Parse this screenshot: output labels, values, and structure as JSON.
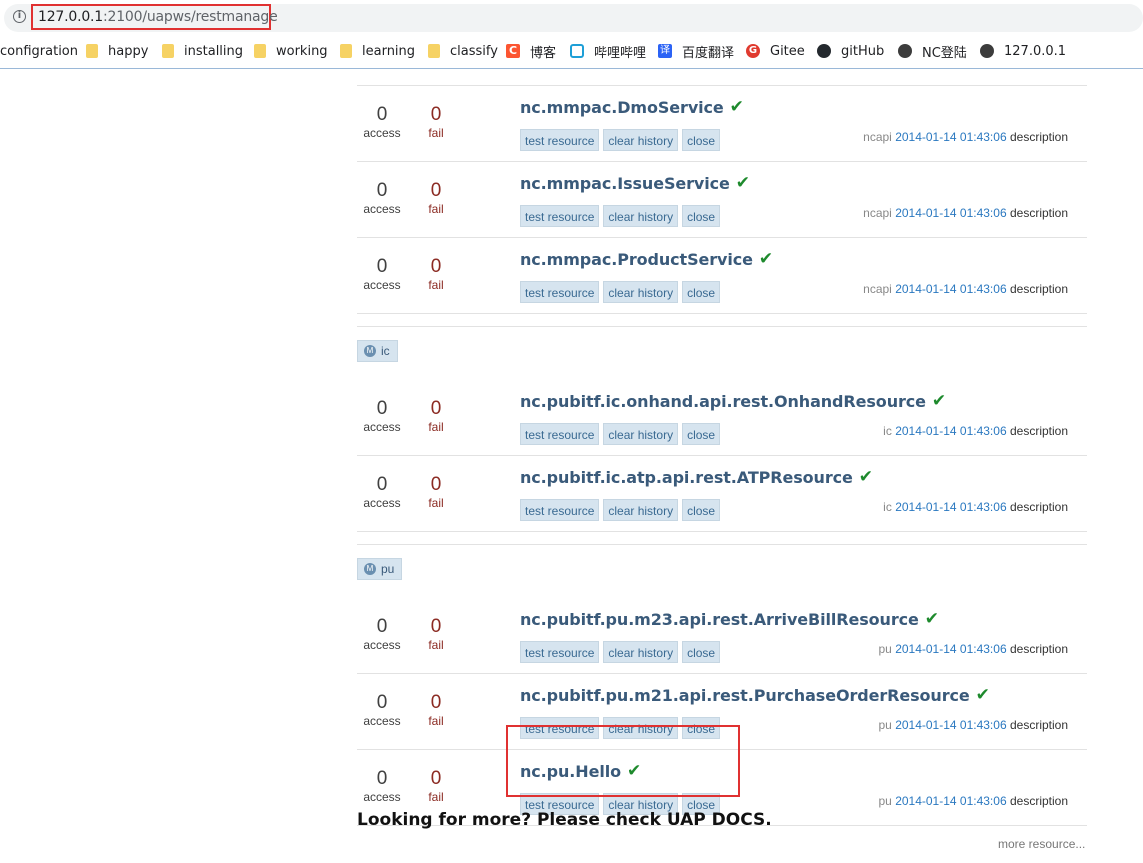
{
  "browser": {
    "url_host": "127.0.0.1",
    "url_rest": ":2100/uapws/restmanage",
    "bookmarks": [
      {
        "label": "configration",
        "icon": "none"
      },
      {
        "label": "happy",
        "icon": "folder-icon"
      },
      {
        "label": "installing",
        "icon": "folder-icon"
      },
      {
        "label": "working",
        "icon": "folder-icon"
      },
      {
        "label": "learning",
        "icon": "folder-icon"
      },
      {
        "label": "classify",
        "icon": "folder-icon"
      },
      {
        "label": "博客",
        "icon": "csdn-icon"
      },
      {
        "label": "哔哩哔哩",
        "icon": "bilibili-icon"
      },
      {
        "label": "百度翻译",
        "icon": "translate-icon"
      },
      {
        "label": "Gitee",
        "icon": "gitee-icon"
      },
      {
        "label": "gitHub",
        "icon": "github-icon"
      },
      {
        "label": "NC登陆",
        "icon": "globe-icon"
      },
      {
        "label": "127.0.0.1",
        "icon": "globe-icon"
      }
    ]
  },
  "labels": {
    "access": "access",
    "fail": "fail",
    "test": "test resource",
    "clear": "clear history",
    "close": "close",
    "description": "description"
  },
  "sections": [
    {
      "group": null,
      "resources": [
        {
          "name": "nc.mmpac.DmoService",
          "access": "0",
          "fail": "0",
          "owner": "ncapi",
          "date": "2014-01-14 01:43:06"
        },
        {
          "name": "nc.mmpac.IssueService",
          "access": "0",
          "fail": "0",
          "owner": "ncapi",
          "date": "2014-01-14 01:43:06"
        },
        {
          "name": "nc.mmpac.ProductService",
          "access": "0",
          "fail": "0",
          "owner": "ncapi",
          "date": "2014-01-14 01:43:06"
        }
      ]
    },
    {
      "group": "ic",
      "resources": [
        {
          "name": "nc.pubitf.ic.onhand.api.rest.OnhandResource",
          "access": "0",
          "fail": "0",
          "owner": "ic",
          "date": "2014-01-14 01:43:06"
        },
        {
          "name": "nc.pubitf.ic.atp.api.rest.ATPResource",
          "access": "0",
          "fail": "0",
          "owner": "ic",
          "date": "2014-01-14 01:43:06"
        }
      ]
    },
    {
      "group": "pu",
      "resources": [
        {
          "name": "nc.pubitf.pu.m23.api.rest.ArriveBillResource",
          "access": "0",
          "fail": "0",
          "owner": "pu",
          "date": "2014-01-14 01:43:06"
        },
        {
          "name": "nc.pubitf.pu.m21.api.rest.PurchaseOrderResource",
          "access": "0",
          "fail": "0",
          "owner": "pu",
          "date": "2014-01-14 01:43:06"
        },
        {
          "name": "nc.pu.Hello",
          "access": "0",
          "fail": "0",
          "owner": "pu",
          "date": "2014-01-14 01:43:06"
        }
      ]
    }
  ],
  "footer": {
    "title": "Looking for more? Please check UAP DOCS.",
    "more": "more resource..."
  }
}
